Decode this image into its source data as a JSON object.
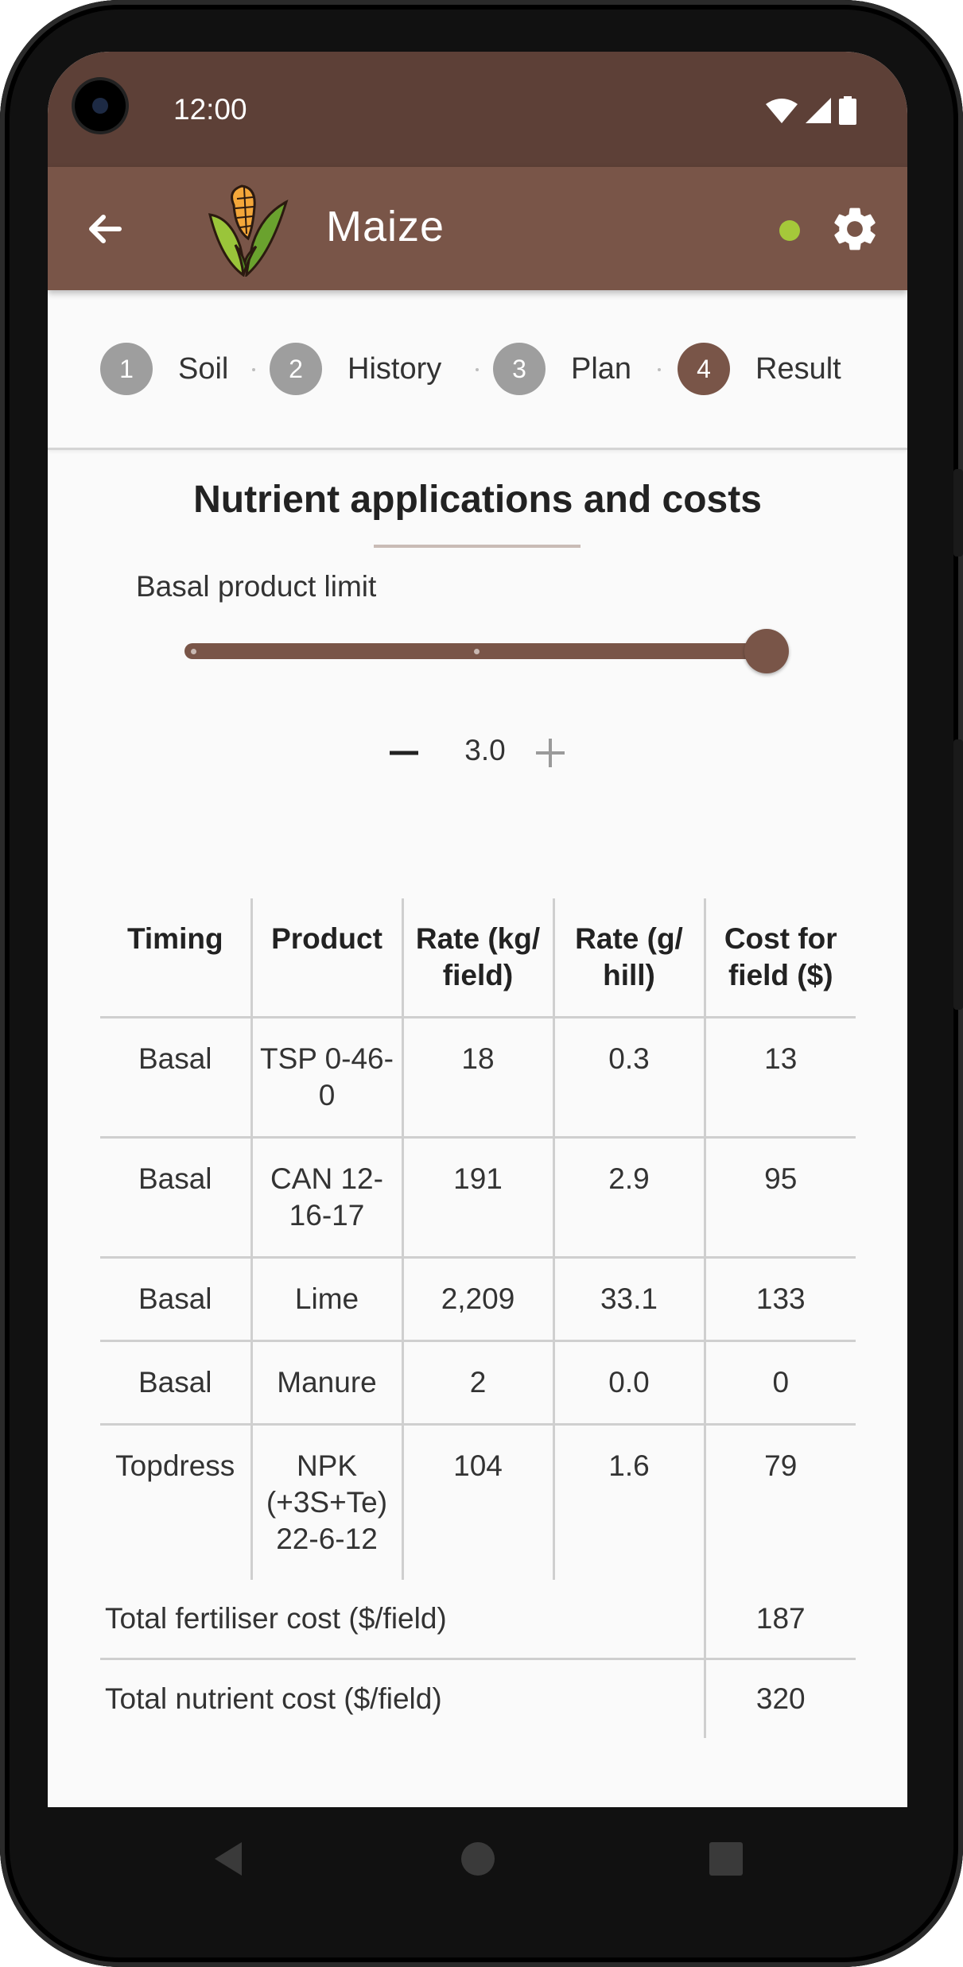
{
  "status_bar": {
    "time": "12:00"
  },
  "app_bar": {
    "title": "Maize"
  },
  "stepper": {
    "steps": [
      {
        "number": "1",
        "label": "Soil",
        "state": "done"
      },
      {
        "number": "2",
        "label": "History",
        "state": "done"
      },
      {
        "number": "3",
        "label": "Plan",
        "state": "done"
      },
      {
        "number": "4",
        "label": "Result",
        "state": "active"
      }
    ]
  },
  "result": {
    "title": "Nutrient applications and costs",
    "slider": {
      "label": "Basal product limit",
      "level": 1.0
    },
    "quantity": {
      "value": "3.0",
      "minus_symbol": "−",
      "plus_symbol": "+"
    },
    "table": {
      "headers": [
        "Timing",
        "Product",
        "Rate (kg/ field)",
        "Rate (g/ hill)",
        "Cost for field ($)"
      ],
      "rows": [
        {
          "timing": "Basal",
          "product": "TSP 0-46-0",
          "rate_kg": "18",
          "rate_g": "0.3",
          "cost": "13"
        },
        {
          "timing": "Basal",
          "product": "CAN 12-16-17",
          "rate_kg": "191",
          "rate_g": "2.9",
          "cost": "95"
        },
        {
          "timing": "Basal",
          "product": "Lime",
          "rate_kg": "2,209",
          "rate_g": "33.1",
          "cost": "133"
        },
        {
          "timing": "Basal",
          "product": "Manure",
          "rate_kg": "2",
          "rate_g": "0.0",
          "cost": "0"
        },
        {
          "timing": "Topdress",
          "product": "NPK (+3S+Te) 22-6-12",
          "rate_kg": "104",
          "rate_g": "1.6",
          "cost": "79"
        }
      ],
      "totals": [
        {
          "label": "Total fertiliser cost ($/field)",
          "value": "187"
        },
        {
          "label": "Total nutrient cost ($/field)",
          "value": "320"
        }
      ]
    }
  },
  "colors": {
    "status_bar": "#5d4037",
    "app_bar": "#795548",
    "accent": "#795548",
    "online_indicator": "#a5c83a",
    "inactive_step": "#9e9e9e"
  },
  "icons": {
    "back": "arrow-left-icon",
    "logo": "maize-cob-icon",
    "settings": "gear-icon",
    "wifi": "wifi-icon",
    "signal": "signal-icon",
    "battery": "battery-icon",
    "nav_back": "triangle-back-icon",
    "nav_home": "circle-home-icon",
    "nav_recents": "square-recents-icon"
  }
}
